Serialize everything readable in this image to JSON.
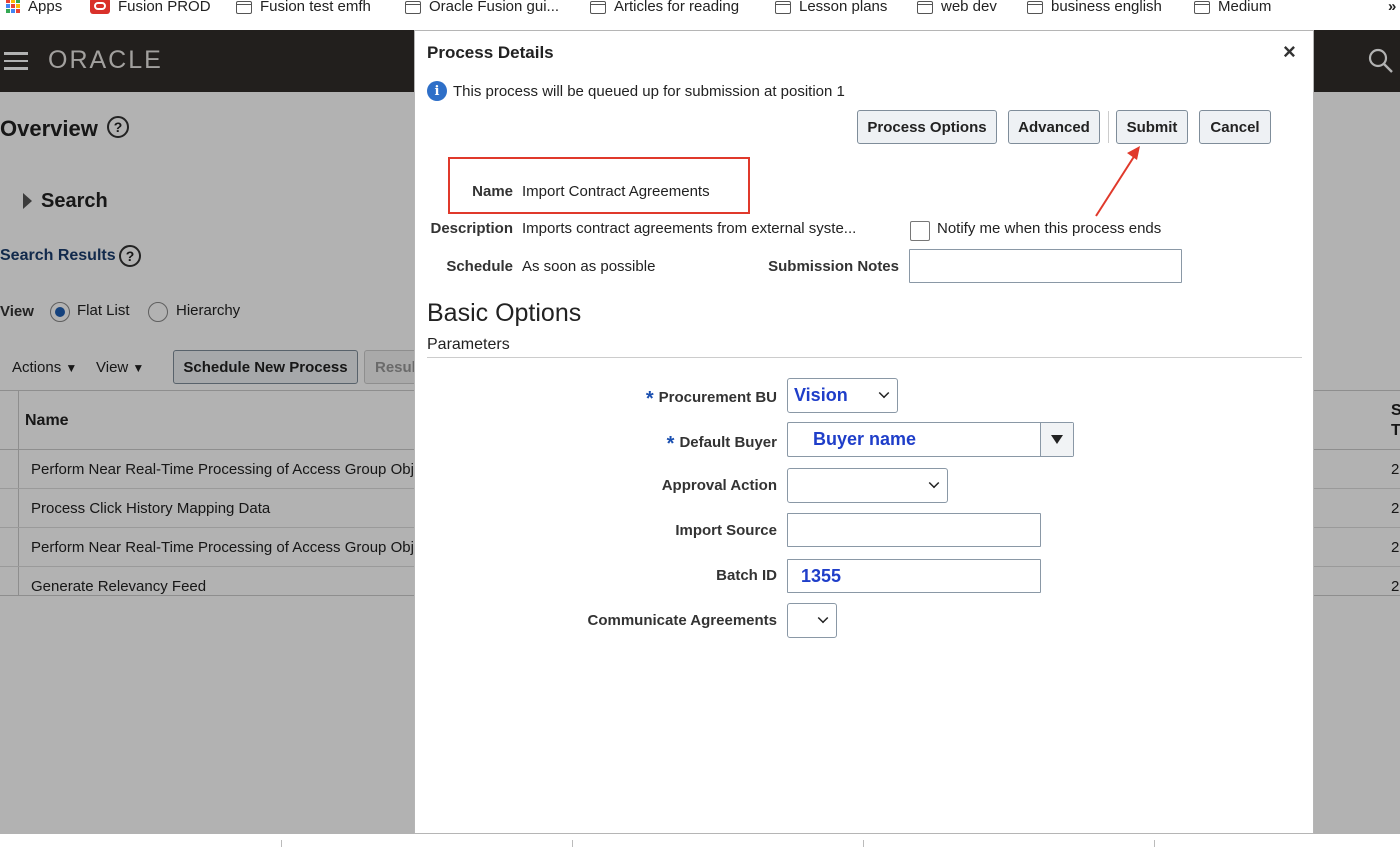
{
  "bookmarks": [
    {
      "label": "Apps"
    },
    {
      "label": "Fusion PROD"
    },
    {
      "label": "Fusion test emfh"
    },
    {
      "label": "Oracle Fusion gui..."
    },
    {
      "label": "Articles for reading"
    },
    {
      "label": "Lesson plans"
    },
    {
      "label": "web dev"
    },
    {
      "label": "business english"
    },
    {
      "label": "Medium"
    }
  ],
  "bookmarks_more": "»",
  "brand": {
    "logo": "ORACLE",
    "menu_icon": "hamburger-icon",
    "search_icon": "search-icon"
  },
  "background": {
    "page_title": "Overview",
    "search_label": "Search",
    "search_results_label": "Search Results",
    "view_label": "View",
    "radio_flat_list": "Flat List",
    "radio_hierarchy": "Hierarchy",
    "actions_menu": "Actions",
    "view_menu": "View",
    "schedule_button": "Schedule New Process",
    "results_button_partial": "Resul",
    "column_name": "Name",
    "column_partial_top": "S",
    "column_partial_bottom": "T",
    "rows": [
      {
        "name": "Perform Near Real-Time Processing of Access Group Obj",
        "partial": "2"
      },
      {
        "name": "Process Click History Mapping Data",
        "partial": "2"
      },
      {
        "name": "Perform Near Real-Time Processing of Access Group Obj",
        "partial": "2"
      },
      {
        "name": "Generate Relevancy Feed",
        "partial": "2"
      }
    ]
  },
  "dialog": {
    "title": "Process Details",
    "close_glyph": "×",
    "info_text": "This process will be queued up for submission at position 1",
    "buttons": {
      "process_options": "Process Options",
      "advanced": "Advanced",
      "submit": "Submit",
      "cancel": "Cancel"
    },
    "name_label": "Name",
    "name_value": "Import Contract Agreements",
    "description_label": "Description",
    "description_value": "Imports contract agreements from external syste...",
    "notify_label": "Notify me when this process ends",
    "schedule_label": "Schedule",
    "schedule_value": "As soon as possible",
    "submission_notes_label": "Submission Notes",
    "submission_notes_value": "",
    "section_title": "Basic Options",
    "section_subtitle": "Parameters",
    "params": {
      "procurement_bu_label": "Procurement BU",
      "procurement_bu_value": "Vision",
      "default_buyer_label": "Default Buyer",
      "default_buyer_value": "Buyer name",
      "approval_action_label": "Approval Action",
      "approval_action_value": "",
      "import_source_label": "Import Source",
      "import_source_value": "",
      "batch_id_label": "Batch ID",
      "batch_id_value": "1355",
      "communicate_agreements_label": "Communicate Agreements",
      "communicate_agreements_value": ""
    },
    "required_marker": "*"
  },
  "annotation": {
    "highlight_color": "#e0392b",
    "arrow_color": "#e0392b"
  }
}
